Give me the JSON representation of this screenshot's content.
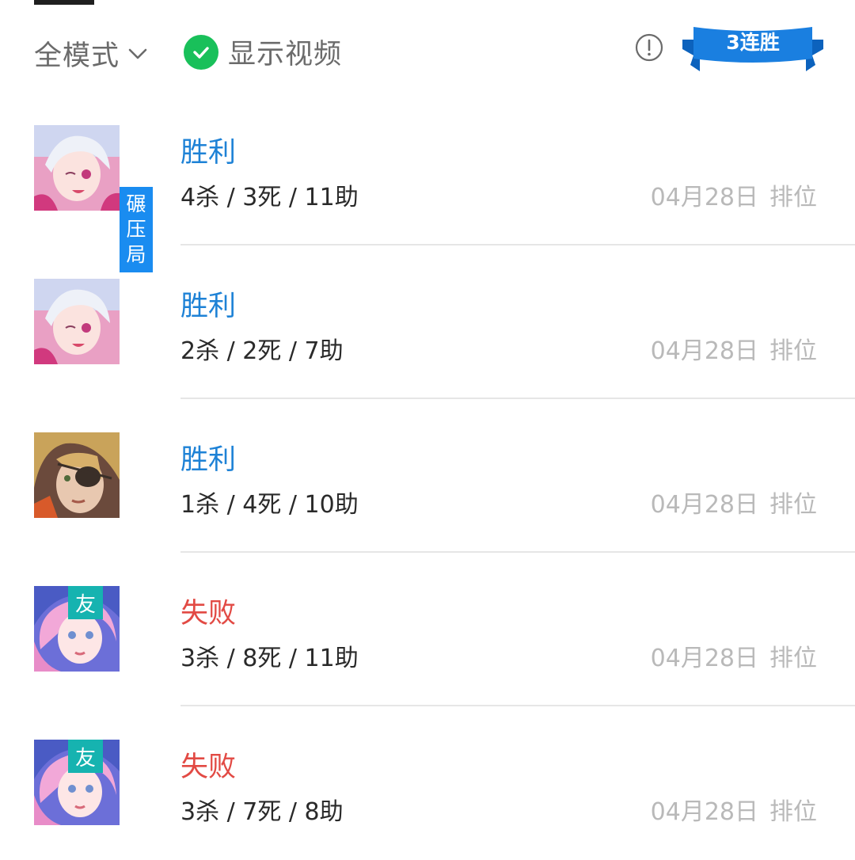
{
  "filters": {
    "mode_label": "全模式",
    "video_label": "显示视频",
    "video_enabled": true
  },
  "streak": {
    "label": "3连胜",
    "color": "#1a7fe0"
  },
  "colors": {
    "win": "#1e82d6",
    "loss": "#e24a44",
    "check": "#19c05a",
    "tag_blue": "#1a8cf0",
    "tag_teal": "#16b3b0"
  },
  "matches": [
    {
      "result": "胜利",
      "outcome": "win",
      "kda": "4杀 / 3死 / 11助",
      "date": "04月28日",
      "type": "排位",
      "hero_avatar": "white-hair-hero-avatar"
    },
    {
      "result": "胜利",
      "outcome": "win",
      "kda": "2杀 / 2死 / 7助",
      "date": "04月28日",
      "type": "排位",
      "badge": [
        "碾",
        "压",
        "局"
      ],
      "hero_avatar": "white-hair-hero-avatar"
    },
    {
      "result": "胜利",
      "outcome": "win",
      "kda": "1杀 / 4死 / 10助",
      "date": "04月28日",
      "type": "排位",
      "hero_avatar": "eyepatch-hero-avatar"
    },
    {
      "result": "失败",
      "outcome": "loss",
      "kda": "3杀 / 8死 / 11助",
      "date": "04月28日",
      "type": "排位",
      "friend_tag": "友",
      "hero_avatar": "pink-hair-hero-avatar"
    },
    {
      "result": "失败",
      "outcome": "loss",
      "kda": "3杀 / 7死 / 8助",
      "date": "04月28日",
      "type": "排位",
      "friend_tag": "友",
      "hero_avatar": "pink-hair-hero-avatar"
    }
  ]
}
